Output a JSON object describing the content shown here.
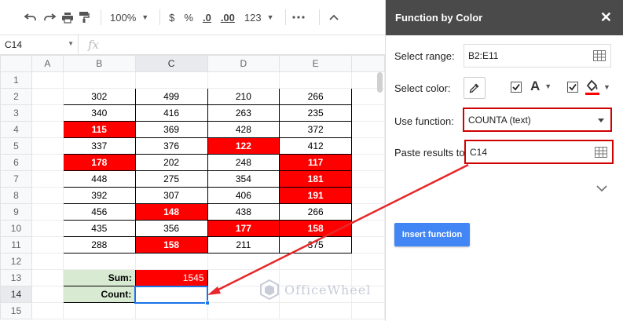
{
  "toolbar": {
    "zoom": "100%",
    "currency": "$",
    "percent": "%",
    "dec_less": ".0",
    "dec_more": ".00",
    "format_more": "123"
  },
  "formula_bar": {
    "cell_ref": "C14",
    "fx": "fx"
  },
  "grid": {
    "columns": [
      "A",
      "B",
      "C",
      "D",
      "E"
    ],
    "rows": [
      "1",
      "2",
      "3",
      "4",
      "5",
      "6",
      "7",
      "8",
      "9",
      "10",
      "11",
      "12",
      "13",
      "14",
      "15"
    ],
    "data": [
      [
        "302",
        "499",
        "210",
        "266"
      ],
      [
        "340",
        "416",
        "263",
        "235"
      ],
      [
        "115",
        "369",
        "428",
        "372"
      ],
      [
        "337",
        "376",
        "122",
        "412"
      ],
      [
        "178",
        "202",
        "248",
        "117"
      ],
      [
        "448",
        "275",
        "354",
        "181"
      ],
      [
        "392",
        "307",
        "406",
        "191"
      ],
      [
        "456",
        "148",
        "438",
        "266"
      ],
      [
        "435",
        "356",
        "177",
        "158"
      ],
      [
        "288",
        "158",
        "211",
        "375"
      ]
    ],
    "sum_label": "Sum:",
    "sum_value": "1545",
    "count_label": "Count:"
  },
  "panel": {
    "title": "Function by Color",
    "select_range_label": "Select range:",
    "select_range_value": "B2:E11",
    "select_color_label": "Select color:",
    "font_letter": "A",
    "use_function_label": "Use function:",
    "use_function_value": "COUNTA (text)",
    "paste_results_label": "Paste results to:",
    "paste_results_value": "C14",
    "insert_button": "Insert function"
  },
  "watermark": "OfficeWheel",
  "colors": {
    "red": "#ff0000",
    "label_green": "#d9ead3",
    "accent_blue": "#4285f4",
    "panel_header": "#4a4a4a",
    "highlight_red": "#d00000"
  }
}
